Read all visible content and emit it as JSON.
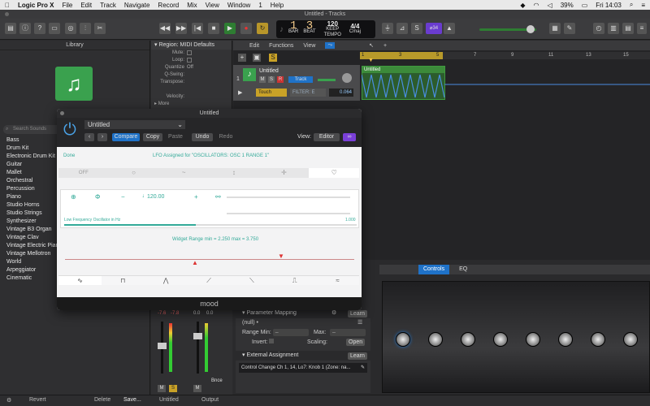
{
  "menubar": {
    "app": "Logic Pro X",
    "items": [
      "File",
      "Edit",
      "Track",
      "Navigate",
      "Record",
      "Mix",
      "View",
      "Window",
      "1",
      "Help"
    ],
    "battery": "39%",
    "clock": "Fri 14:03"
  },
  "window_title": "Untitled - Tracks",
  "lcd": {
    "bar": "1",
    "beat": "3",
    "bar_label": "BAR",
    "beat_label": "BEAT",
    "tempo": "120",
    "tempo_label": "KEEP",
    "tempo_sub": "TEMPO",
    "sig": "4/4",
    "key": "Cmaj"
  },
  "cpu_badge": "⌀34",
  "library": {
    "title": "Library",
    "search_placeholder": "Search Sounds",
    "items": [
      "Bass",
      "Drum Kit",
      "Electronic Drum Kit",
      "Guitar",
      "Mallet",
      "Orchestral",
      "Percussion",
      "Piano",
      "Studio Horns",
      "Studio Strings",
      "Synthesizer",
      "Vintage B3 Organ",
      "Vintage Clav",
      "Vintage Electric Piano",
      "Vintage Mellotron",
      "World",
      "Arpeggiator",
      "Cinematic"
    ]
  },
  "inspector": {
    "region_title": "Region: MIDI Defaults",
    "rows": [
      {
        "k": "Mute:",
        "v": ""
      },
      {
        "k": "Loop:",
        "v": ""
      },
      {
        "k": "Quantize",
        "v": "Off"
      },
      {
        "k": "Q-Swing:",
        "v": ""
      },
      {
        "k": "Transpose:",
        "v": ""
      },
      {
        "k": "",
        "v": ""
      },
      {
        "k": "Velocity:",
        "v": ""
      }
    ],
    "more": "More"
  },
  "tracks": {
    "edit": "Edit",
    "functions": "Functions",
    "view": "View",
    "ruler": [
      "1",
      "3",
      "5",
      "7",
      "9",
      "11",
      "13",
      "15"
    ],
    "track_num": "1",
    "track_name": "Untitled",
    "automation_mode": "Touch",
    "automation_param": "FILTER: E",
    "automation_value": "0.064",
    "track_btn": "Track",
    "m": "M",
    "s": "S",
    "r": "R",
    "region_name": "Untitled"
  },
  "plugin": {
    "title": "Untitled",
    "preset": "Untitled",
    "compare": "Compare",
    "copy": "Copy",
    "paste": "Paste",
    "undo": "Undo",
    "redo": "Redo",
    "view_label": "View:",
    "view_value": "Editor",
    "done": "Done",
    "lfo_text": "LFO Assigned for \"OSCILLATORS: OSC 1 RANGE 1\"",
    "off": "OFF",
    "tempo_val": "120.00",
    "tempo_note": "♩",
    "freq_label": "Low Frequency Oscillator in Hz",
    "freq_val": "1.000",
    "widget_range": "Widget Range min = 2.250 max = 3.750",
    "footer": "mood"
  },
  "lower": {
    "tab_controls": "Controls",
    "tab_eq": "EQ",
    "param_mapping": "Parameter Mapping",
    "learn": "Learn",
    "null": "(null) •",
    "range_min": "Range Min:",
    "max": "Max:",
    "invert": "Invert:",
    "scaling": "Scaling:",
    "open": "Open",
    "external": "External Assignment",
    "learn2": "Learn",
    "cc_text": "Control Change Ch 1, 14, Lo7: Knob 1 (Zone: na..."
  },
  "mixer": {
    "val1": "-7.6",
    "val2": "-7.8",
    "val3": "0.0",
    "val4": "0.0",
    "bnce": "Bnce",
    "m": "M",
    "s": "S",
    "m2": "M",
    "untitled": "Untitled",
    "output": "Output"
  },
  "bottombar": {
    "revert": "Revert",
    "delete": "Delete",
    "save": "Save..."
  },
  "colors": {
    "accent_green": "#3aa14e",
    "accent_blue": "#1f72c8",
    "record_red": "#d33",
    "lcd_orange": "#f2c98a"
  }
}
